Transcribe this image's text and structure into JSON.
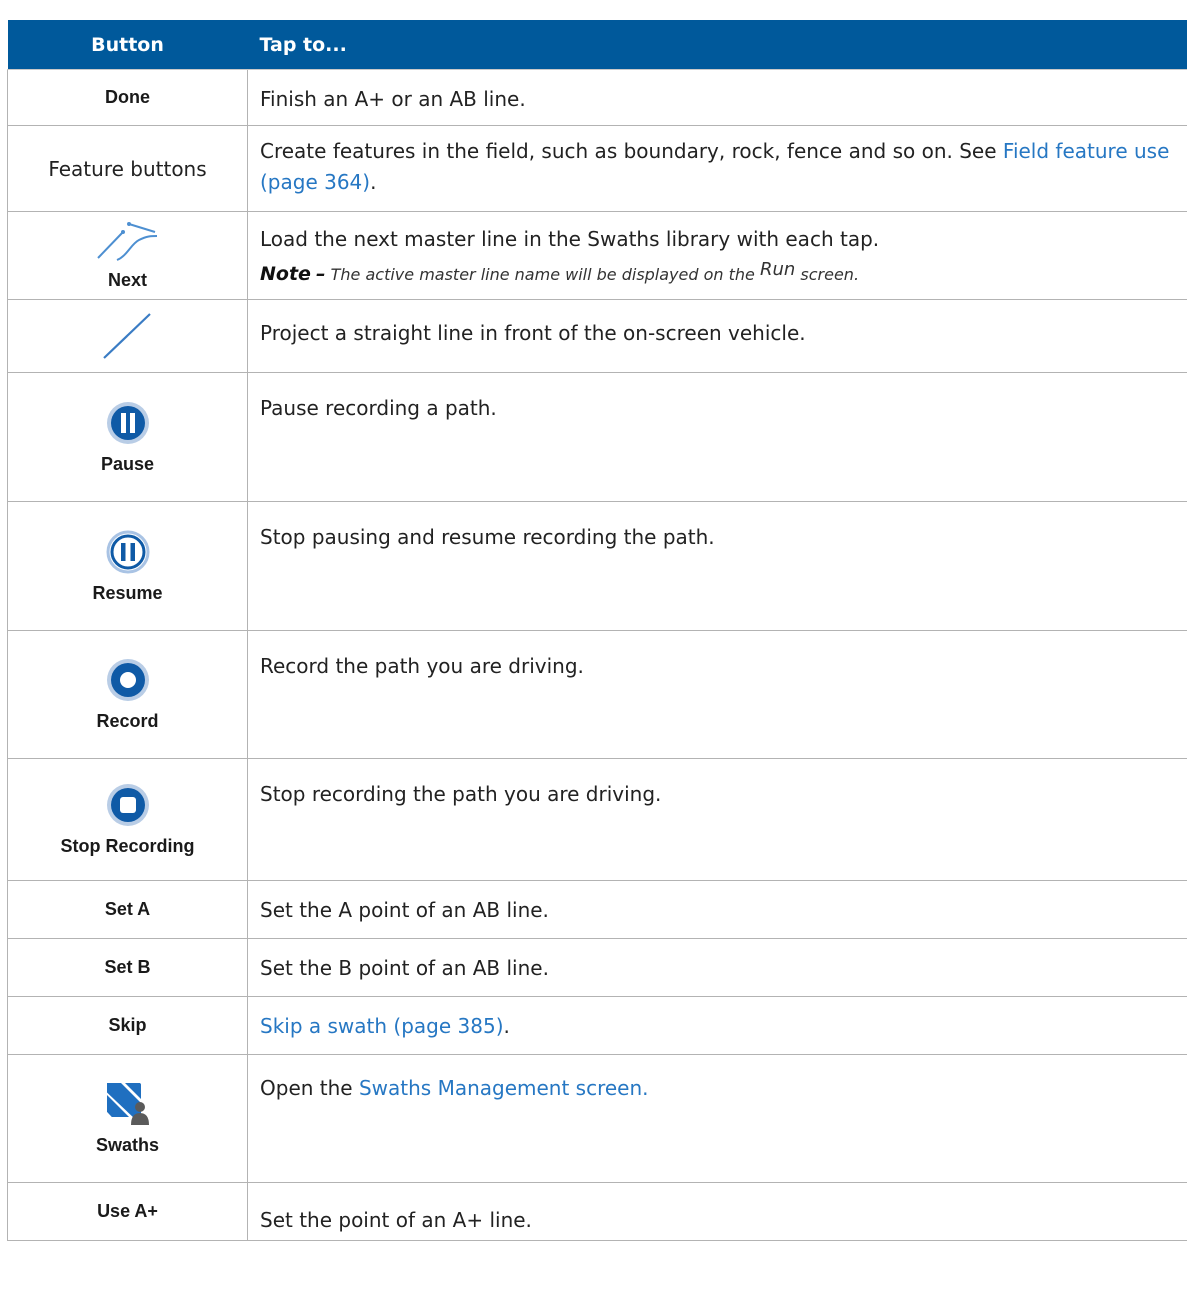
{
  "table": {
    "header": {
      "col1": "Button",
      "col2": "Tap to..."
    },
    "rows": {
      "done": {
        "label": "Done",
        "desc": "Finish an A+ or an AB line."
      },
      "feature": {
        "label": "Feature buttons",
        "desc_prefix": "Create features in the field, such as boundary, rock, fence and so on. See ",
        "link": "Field feature use (page 364)",
        "desc_suffix": "."
      },
      "next": {
        "label": "Next",
        "icon": "next-line-icon",
        "desc": "Load the next master line in the Swaths library with each tap.",
        "note_word": "Note",
        "note_dash": "–",
        "note_text": "The active master line name will be displayed on the",
        "note_run": "Run",
        "note_end": "screen."
      },
      "straight": {
        "icon": "straight-line-icon",
        "desc": "Project a straight line in front of the on-screen vehicle."
      },
      "pause": {
        "label": "Pause",
        "icon": "pause-icon",
        "desc": "Pause recording a path."
      },
      "resume": {
        "label": "Resume",
        "icon": "resume-icon",
        "desc": "Stop pausing and resume recording the path."
      },
      "record": {
        "label": "Record",
        "icon": "record-icon",
        "desc": "Record the path you are driving."
      },
      "stop": {
        "label": "Stop Recording",
        "icon": "stop-recording-icon",
        "desc": "Stop recording the path you are driving."
      },
      "set_a": {
        "label": "Set A",
        "desc": "Set the A point of an AB line."
      },
      "set_b": {
        "label": "Set B",
        "desc": "Set the B point of an AB line."
      },
      "skip": {
        "label": "Skip",
        "link": "Skip a swath (page 385)",
        "desc_suffix": "."
      },
      "swaths": {
        "label": "Swaths",
        "icon": "swaths-icon",
        "desc_prefix": "Open the",
        "link": "Swaths Management screen."
      },
      "use_a_plus": {
        "label": "Use A+",
        "desc": "Set the point of an A+ line."
      }
    }
  },
  "colors": {
    "header_bg": "#00599b",
    "link": "#2677c3",
    "icon_blue": "#0f5aa6"
  }
}
